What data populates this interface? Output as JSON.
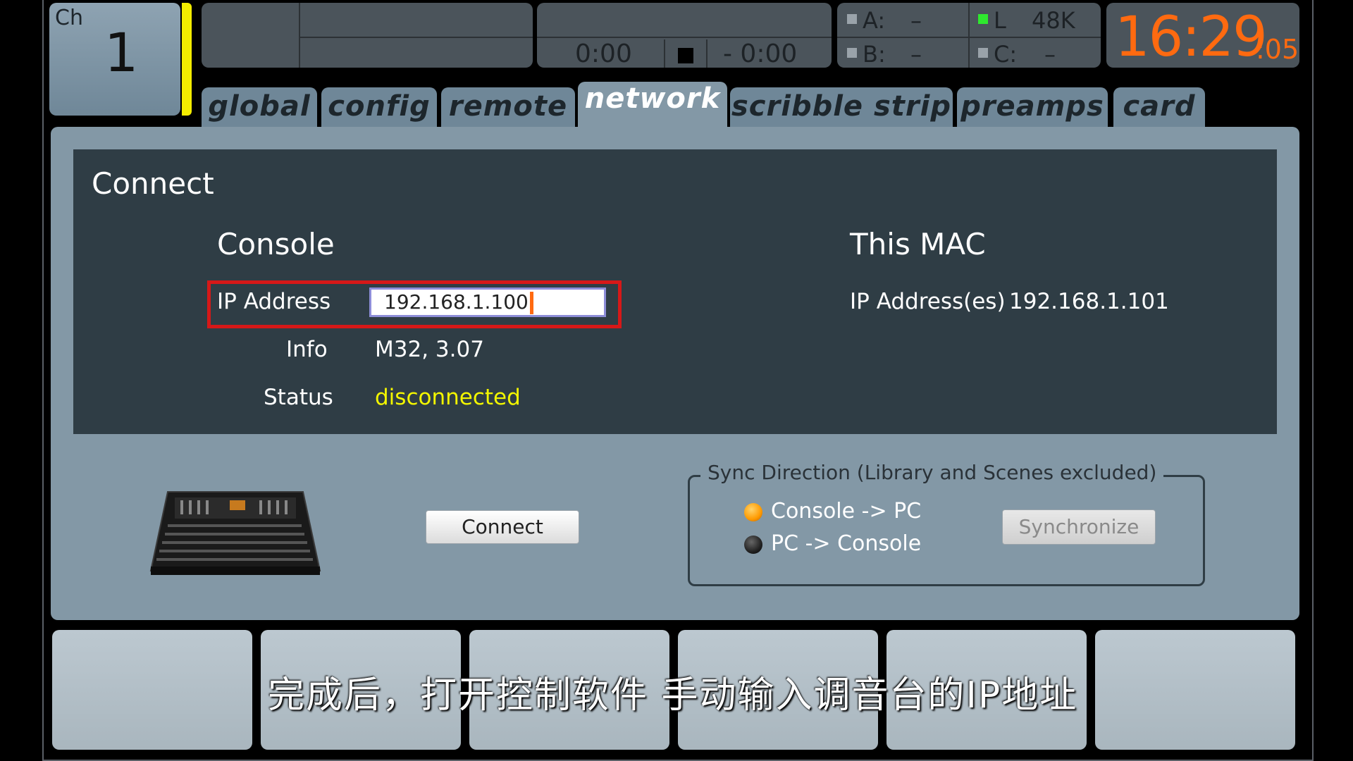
{
  "header": {
    "channel_label": "Ch",
    "channel_number": "1",
    "transport": {
      "elapsed": "0:00",
      "remaining": "- 0:00"
    },
    "status": {
      "a_label": "A:",
      "a_value": "–",
      "b_label": "B:",
      "b_value": "–",
      "l_label": "L",
      "l_value": "48K",
      "c_label": "C:",
      "c_value": "–"
    },
    "clock": {
      "time": "16:29",
      "seconds": ":05"
    }
  },
  "tabs": [
    {
      "label": "global"
    },
    {
      "label": "config"
    },
    {
      "label": "remote"
    },
    {
      "label": "network",
      "active": true
    },
    {
      "label": "scribble strip"
    },
    {
      "label": "preamps"
    },
    {
      "label": "card"
    }
  ],
  "connect": {
    "title": "Connect",
    "console": {
      "heading": "Console",
      "ip_label": "IP Address",
      "ip_value": "192.168.1.100",
      "info_label": "Info",
      "info_value": "M32, 3.07",
      "status_label": "Status",
      "status_value": "disconnected"
    },
    "this_mac": {
      "heading": "This MAC",
      "ip_label": "IP Address(es)",
      "ip_value": "192.168.1.101"
    },
    "connect_button": "Connect",
    "sync": {
      "legend": "Sync Direction (Library and Scenes excluded)",
      "option1": "Console -> PC",
      "option2": "PC -> Console",
      "selected": "Console -> PC",
      "button": "Synchronize"
    }
  },
  "subtitle": "完成后，打开控制软件 手动输入调音台的IP地址",
  "colors": {
    "clock": "#ff6a10",
    "status_disconnected": "#f2f500",
    "highlight_box": "#d61818",
    "channel_bar": "#f3ec00"
  }
}
